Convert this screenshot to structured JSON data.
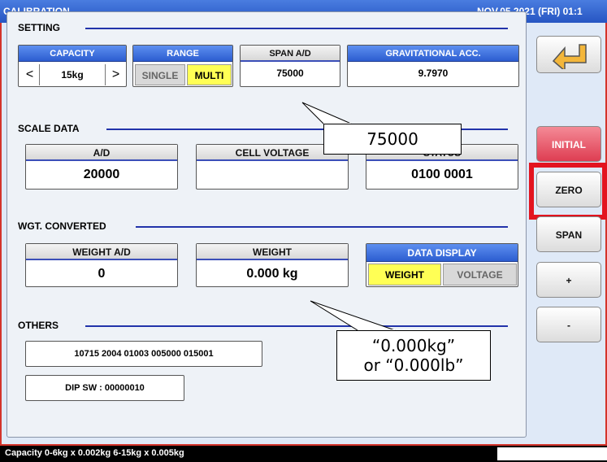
{
  "title": {
    "left": "CALIBRATION",
    "right": "NOV.05.2021 (FRI) 01:1"
  },
  "setting": {
    "section_label": "SETTING",
    "capacity": {
      "header": "CAPACITY",
      "prev": "<",
      "value": "15kg",
      "next": ">"
    },
    "range": {
      "header": "RANGE",
      "single": "SINGLE",
      "multi": "MULTI",
      "selected": "MULTI"
    },
    "span_ad": {
      "header": "SPAN A/D",
      "value": "75000"
    },
    "grav_acc": {
      "header": "GRAVITATIONAL ACC.",
      "value": "9.7970"
    }
  },
  "scale_data": {
    "section_label": "SCALE DATA",
    "ad": {
      "header": "A/D",
      "value": "20000"
    },
    "cell_voltage": {
      "header": "CELL VOLTAGE",
      "value": ""
    },
    "status": {
      "header": "STATUS",
      "value": "0100 0001"
    }
  },
  "wgt_converted": {
    "section_label": "WGT. CONVERTED",
    "weight_ad": {
      "header": "WEIGHT A/D",
      "value": "0"
    },
    "weight": {
      "header": "WEIGHT",
      "value": "0.000 kg"
    },
    "data_display": {
      "header": "DATA DISPLAY",
      "weight": "WEIGHT",
      "voltage": "VOLTAGE",
      "selected": "WEIGHT"
    }
  },
  "others": {
    "section_label": "OTHERS",
    "serial": "10715 2004 01003 005000 015001",
    "dip_sw": "DIP SW : 00000010"
  },
  "side_buttons": {
    "back_icon": "return-arrow-icon",
    "initial": "INITIAL",
    "zero": "ZERO",
    "span": "SPAN",
    "plus": "+",
    "minus": "-"
  },
  "callouts": {
    "span": "75000",
    "weight_line1": "“0.000kg”",
    "weight_line2": "or “0.000lb”"
  },
  "status_bar": {
    "text": "Capacity 0-6kg x 0.002kg  6-15kg x 0.005kg"
  },
  "colors": {
    "title_blue": "#2f63d6",
    "frame_border": "#d4342b",
    "highlight_red": "#e3141f",
    "selected_yellow": "#ffff55",
    "initial_red": "#e24d60"
  }
}
